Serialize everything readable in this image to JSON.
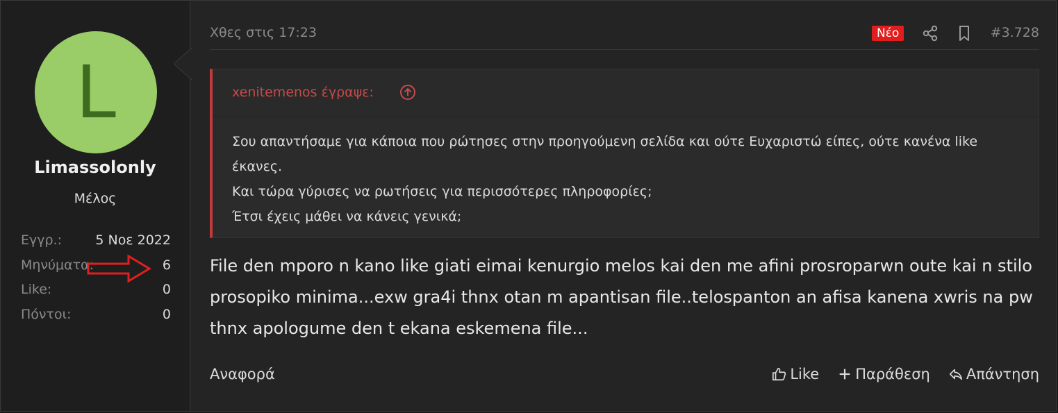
{
  "user": {
    "avatar_letter": "L",
    "avatar_color": "#9acd68",
    "name": "Limassolonly",
    "title": "Μέλος",
    "stats": [
      {
        "key": "Εγγρ.:",
        "value": "5 Νοε 2022"
      },
      {
        "key": "Μηνύματα:",
        "value": "6"
      },
      {
        "key": "Like:",
        "value": "0"
      },
      {
        "key": "Πόντοι:",
        "value": "0"
      }
    ]
  },
  "post": {
    "date": "Χθες στις 17:23",
    "new_badge": "Νέο",
    "number": "#3.728",
    "icons": [
      "share-icon",
      "bookmark-icon"
    ]
  },
  "quote": {
    "author": "xenitemenos έγραψε:",
    "lines": [
      "Σου απαντήσαμε για κάποια που ρώτησες στην προηγούμενη σελίδα και ούτε Ευχαριστώ είπες, ούτε κανένα like έκανες.",
      "Και τώρα γύρισες να ρωτήσεις για περισσότερες πληροφορίες;",
      "Έτσι έχεις μάθει να κάνεις γενικά;"
    ]
  },
  "message": "File den mporo n kano like giati eimai kenurgio melos kai den me afini prosroparwn oute kai n stilo prosopiko minima...exw gra4i thnx otan m apantisan file..telospanton an afisa kanena xwris na pw thnx apologume den t ekana eskemena file...",
  "footer": {
    "report": "Αναφορά",
    "like": "Like",
    "quote": "Παράθεση",
    "reply": "Απάντηση"
  },
  "colors": {
    "accent_red": "#e11d1d",
    "quote_border": "#c33a3a",
    "annotation_arrow": "#e0201f"
  }
}
